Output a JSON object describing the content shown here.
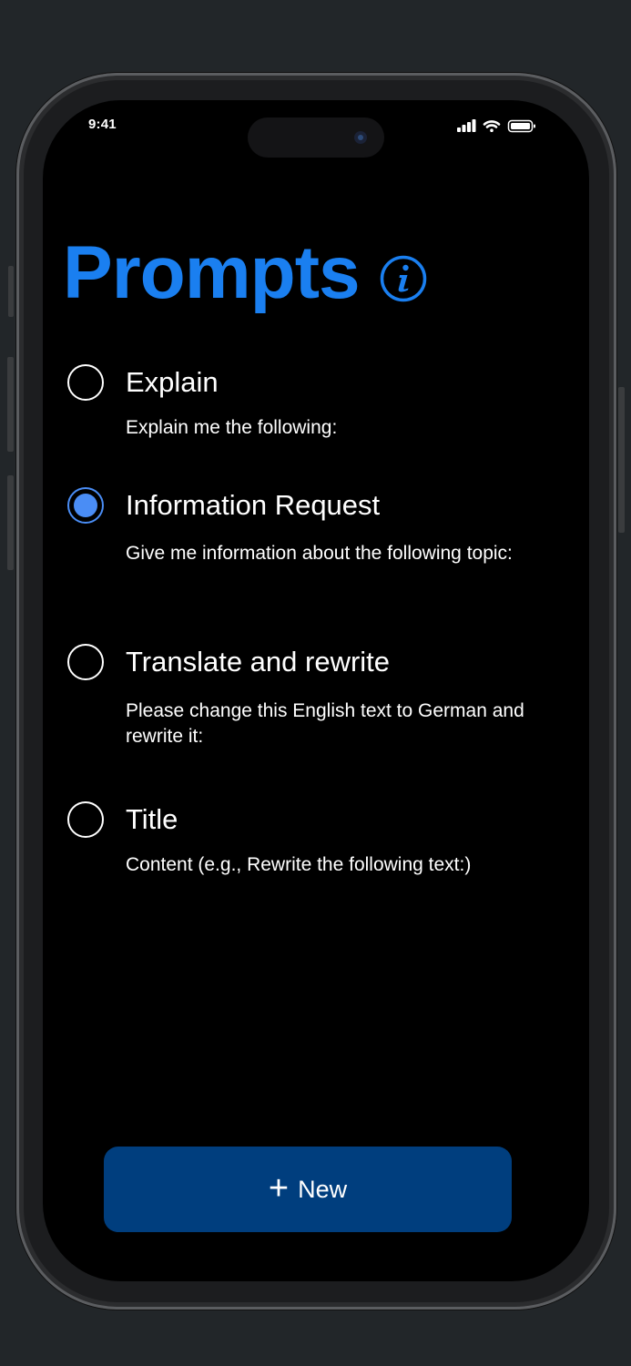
{
  "status_bar": {
    "time": "9:41",
    "icons": [
      "cellular-signal-icon",
      "wifi-icon",
      "battery-icon"
    ]
  },
  "header": {
    "title": "Prompts",
    "info_icon": "info-icon",
    "accent_color": "#1a7ff0"
  },
  "prompts": [
    {
      "title": "Explain",
      "description": "Explain me the following:",
      "selected": false
    },
    {
      "title": "Information Request",
      "description": "Give me information about the following topic:",
      "selected": true
    },
    {
      "title": "Translate and rewrite",
      "description": "Please change this English text to German and rewrite it:",
      "selected": false
    },
    {
      "title": "Title",
      "description": "Content (e.g., Rewrite the following text:)",
      "selected": false
    }
  ],
  "actions": {
    "new_label": "New",
    "new_icon": "plus-icon",
    "button_color": "#003e7e"
  }
}
